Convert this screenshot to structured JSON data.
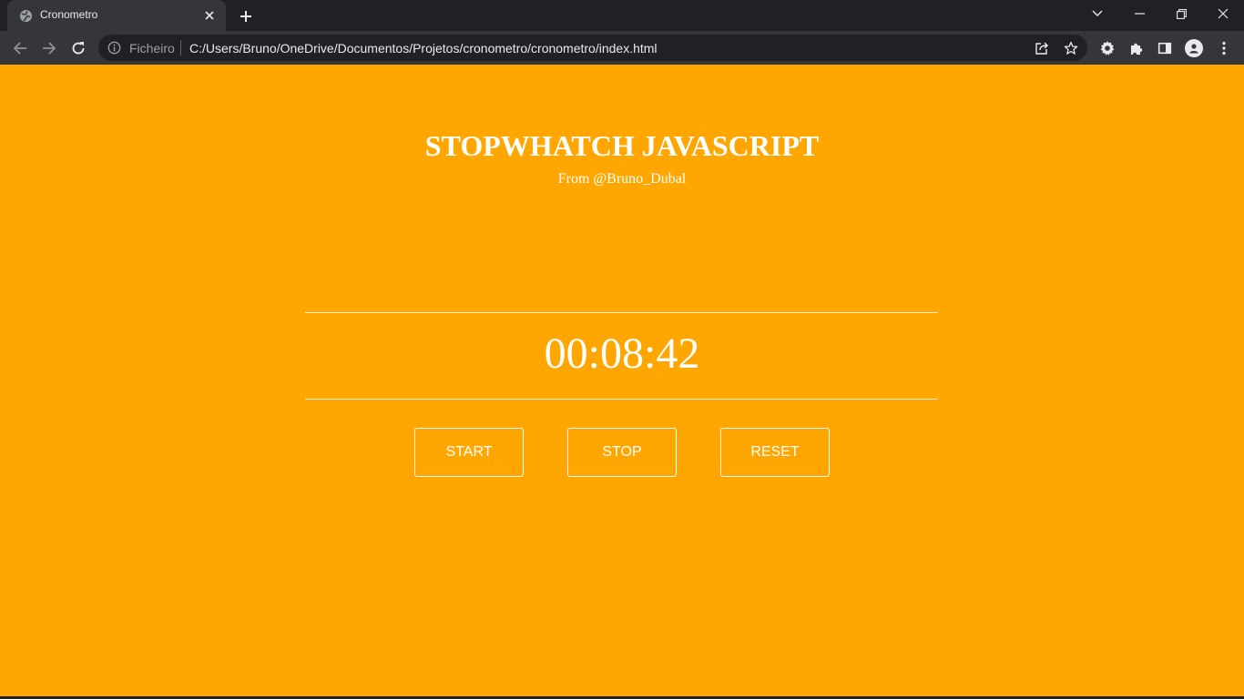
{
  "browser": {
    "tab": {
      "title": "Cronometro",
      "favicon": "globe-icon"
    },
    "omnibox": {
      "security_label": "Ficheiro",
      "url": "C:/Users/Bruno/OneDrive/Documentos/Projetos/cronometro/cronometro/index.html"
    },
    "colors": {
      "frame": "#202124",
      "toolbar": "#35363a",
      "text": "#e8eaed"
    }
  },
  "page": {
    "title": "STOPWHATCH JAVASCRIPT",
    "subtitle": "From @Bruno_Dubal",
    "timer": "00:08:42",
    "buttons": {
      "start": "START",
      "stop": "STOP",
      "reset": "RESET"
    },
    "colors": {
      "background": "#ffa600",
      "foreground": "#ffffff"
    }
  }
}
